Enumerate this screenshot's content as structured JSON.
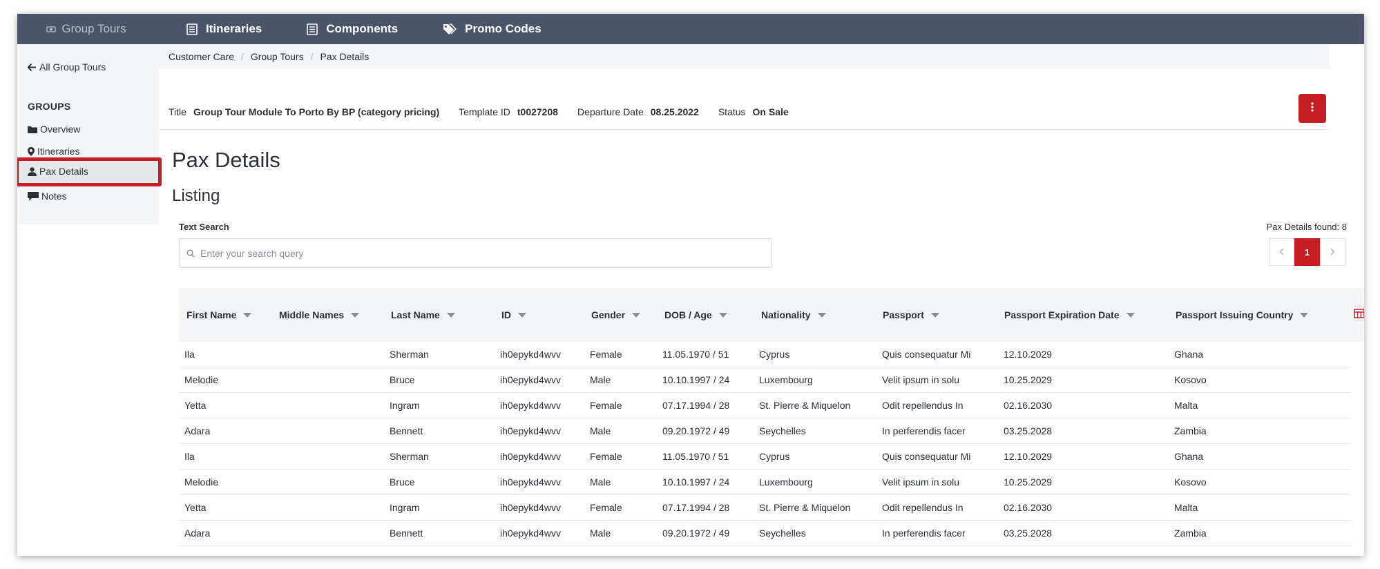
{
  "nav": {
    "brand": "Group Tours",
    "items": [
      {
        "label": "Itineraries",
        "icon": "list-icon"
      },
      {
        "label": "Components",
        "icon": "list-icon"
      },
      {
        "label": "Promo Codes",
        "icon": "tags-icon"
      }
    ]
  },
  "sidebar": {
    "back_label": "All Group Tours",
    "heading": "GROUPS",
    "items": [
      {
        "label": "Overview",
        "icon": "folder-icon"
      },
      {
        "label": "Itineraries",
        "icon": "map-pin-icon"
      },
      {
        "label": "Pax Details",
        "icon": "user-icon",
        "active": true
      },
      {
        "label": "Notes",
        "icon": "comment-icon"
      }
    ]
  },
  "breadcrumb": [
    "Customer Care",
    "Group Tours",
    "Pax Details"
  ],
  "info": {
    "title_label": "Title",
    "title_value": "Group Tour Module To Porto By BP (category pricing)",
    "template_label": "Template ID",
    "template_value": "t0027208",
    "departure_label": "Departure Date",
    "departure_value": "08.25.2022",
    "status_label": "Status",
    "status_value": "On Sale"
  },
  "page_title": "Pax Details",
  "section_title": "Listing",
  "search": {
    "label": "Text Search",
    "placeholder": "Enter your search query"
  },
  "results": {
    "found_text": "Pax Details found: 8",
    "current_page": "1"
  },
  "table": {
    "columns": [
      "First Name",
      "Middle Names",
      "Last Name",
      "ID",
      "Gender",
      "DOB / Age",
      "Nationality",
      "Passport",
      "Passport Expiration Date",
      "Passport Issuing Country"
    ],
    "rows": [
      [
        "Ila",
        "",
        "Sherman",
        "ih0epykd4wvv",
        "Female",
        "11.05.1970 / 51",
        "Cyprus",
        "Quis consequatur Mi",
        "12.10.2029",
        "Ghana"
      ],
      [
        "Melodie",
        "",
        "Bruce",
        "ih0epykd4wvv",
        "Male",
        "10.10.1997 / 24",
        "Luxembourg",
        "Velit ipsum in solu",
        "10.25.2029",
        "Kosovo"
      ],
      [
        "Yetta",
        "",
        "Ingram",
        "ih0epykd4wvv",
        "Female",
        "07.17.1994 / 28",
        "St. Pierre & Miquelon",
        "Odit repellendus In",
        "02.16.2030",
        "Malta"
      ],
      [
        "Adara",
        "",
        "Bennett",
        "ih0epykd4wvv",
        "Male",
        "09.20.1972 / 49",
        "Seychelles",
        "In perferendis facer",
        "03.25.2028",
        "Zambia"
      ],
      [
        "Ila",
        "",
        "Sherman",
        "ih0epykd4wvv",
        "Female",
        "11.05.1970 / 51",
        "Cyprus",
        "Quis consequatur Mi",
        "12.10.2029",
        "Ghana"
      ],
      [
        "Melodie",
        "",
        "Bruce",
        "ih0epykd4wvv",
        "Male",
        "10.10.1997 / 24",
        "Luxembourg",
        "Velit ipsum in solu",
        "10.25.2029",
        "Kosovo"
      ],
      [
        "Yetta",
        "",
        "Ingram",
        "ih0epykd4wvv",
        "Female",
        "07.17.1994 / 28",
        "St. Pierre & Miquelon",
        "Odit repellendus In",
        "02.16.2030",
        "Malta"
      ],
      [
        "Adara",
        "",
        "Bennett",
        "ih0epykd4wvv",
        "Male",
        "09.20.1972 / 49",
        "Seychelles",
        "In perferendis facer",
        "03.25.2028",
        "Zambia"
      ]
    ]
  },
  "colors": {
    "nav_bg": "#4b5468",
    "accent_red": "#c41e24",
    "panel_bg": "#f4f5f7"
  }
}
